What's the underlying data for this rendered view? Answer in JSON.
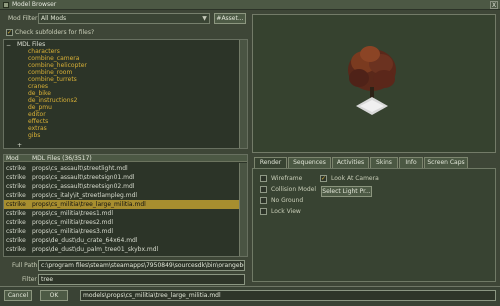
{
  "window": {
    "title": "Model Browser",
    "close_icon_text": "X"
  },
  "filter": {
    "label": "Mod Filter",
    "value": "All Mods",
    "asset_button": "#Asset..."
  },
  "checkbox_subfolders": {
    "label": "Check subfolders for files?",
    "checked": true
  },
  "tree": {
    "root_label": "MDL Files",
    "folders": [
      "characters",
      "combine_camera",
      "combine_helicopter",
      "combine_room",
      "combine_turrets",
      "cranes",
      "de_bike",
      "de_instructions2",
      "de_pmu",
      "editor",
      "effects",
      "extras",
      "gibs"
    ]
  },
  "file_table": {
    "headers": {
      "mod": "Mod",
      "files": "MDL Files (36/3517)"
    },
    "rows": [
      {
        "mod": "cstrike",
        "path": "props\\cs_assault\\streetlight.mdl"
      },
      {
        "mod": "cstrike",
        "path": "props\\cs_assault\\streetsign01.mdl"
      },
      {
        "mod": "cstrike",
        "path": "props\\cs_assault\\streetsign02.mdl"
      },
      {
        "mod": "cstrike",
        "path": "props\\cs_italy\\it_streetlampleg.mdl"
      },
      {
        "mod": "cstrike",
        "path": "props\\cs_militia\\tree_large_militia.mdl",
        "selected": true
      },
      {
        "mod": "cstrike",
        "path": "props\\cs_militia\\trees1.mdl"
      },
      {
        "mod": "cstrike",
        "path": "props\\cs_militia\\trees2.mdl"
      },
      {
        "mod": "cstrike",
        "path": "props\\cs_militia\\trees3.mdl"
      },
      {
        "mod": "cstrike",
        "path": "props\\de_dust\\du_crate_64x64.mdl"
      },
      {
        "mod": "cstrike",
        "path": "props\\de_dust\\du_palm_tree01_skybx.mdl"
      }
    ]
  },
  "full_path": {
    "label": "Full Path",
    "value": "c:\\program files\\steam\\steamapps\\7950849\\sourcesdk\\bin\\orangebox\\"
  },
  "filter_field": {
    "label": "Filter",
    "value": "tree"
  },
  "tabs": [
    "Render",
    "Sequences",
    "Activities",
    "Skins",
    "Info",
    "Screen Caps"
  ],
  "render_options": {
    "wireframe": "Wireframe",
    "collision_model": "Collision Model",
    "no_ground": "No Ground",
    "lock_view": "Lock View",
    "look_at_camera": "Look At Camera",
    "look_at_camera_checked": true,
    "select_light_button": "Select Light Pr..."
  },
  "bottom": {
    "cancel": "Cancel",
    "ok": "OK",
    "model_path": "models\\props\\cs_militia\\tree_large_militia.mdl"
  },
  "colors": {
    "accent_yellow": "#d8b036",
    "selected_row": "#a78e2f",
    "panel_bg": "#2c3428"
  },
  "icons": {
    "tree_expand": "plus-icon",
    "tree_collapse": "minus-icon",
    "check": "checkmark-icon"
  }
}
